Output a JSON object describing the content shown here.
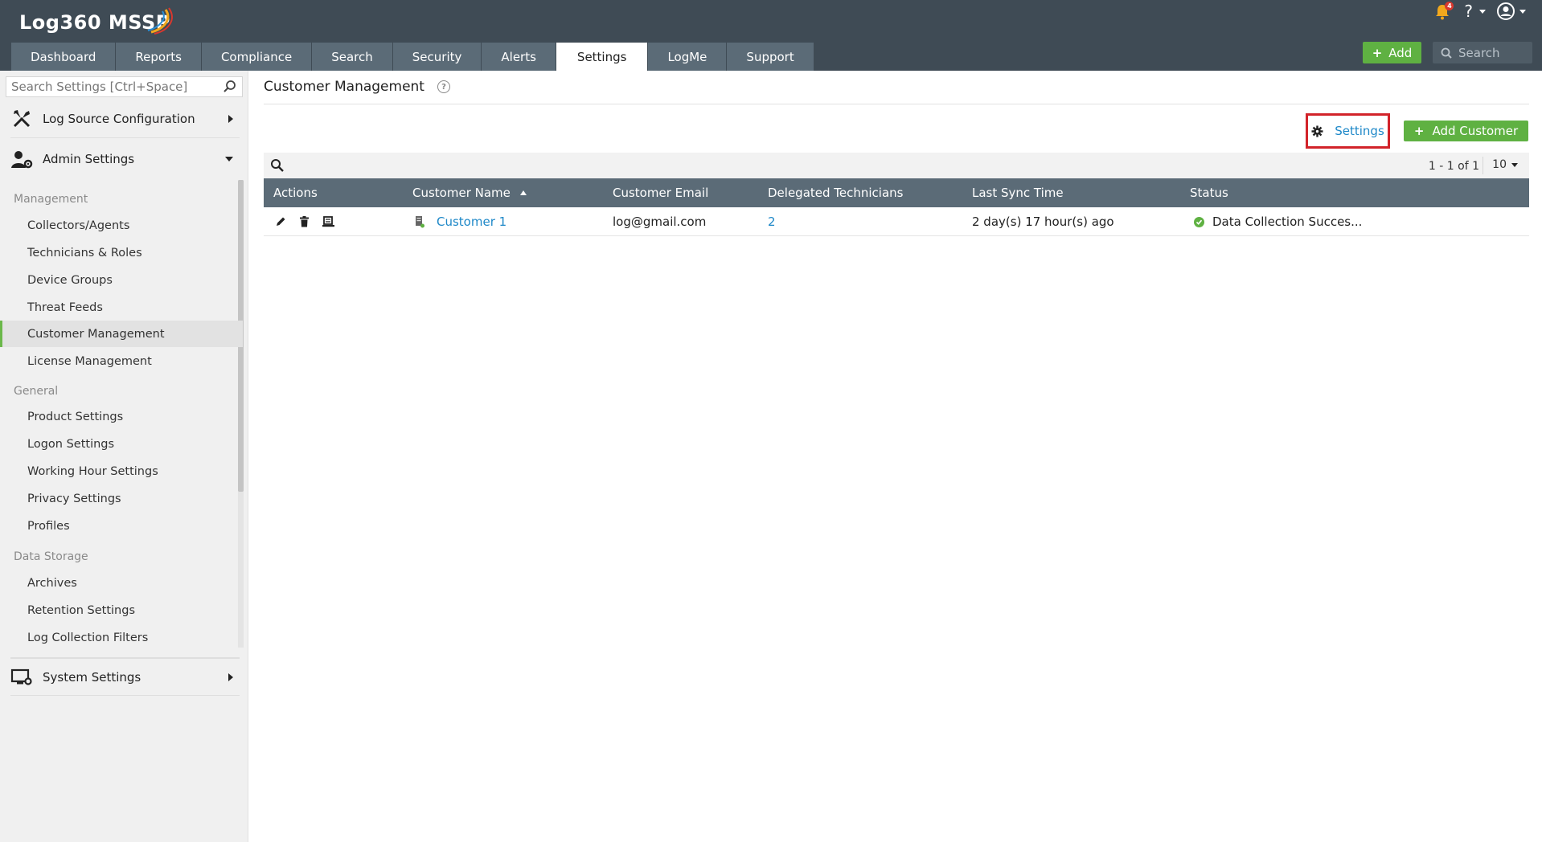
{
  "app": {
    "logo_text": "Log360 MSSP",
    "notification_count": "4",
    "help_label": "?"
  },
  "nav": {
    "tabs": [
      {
        "label": "Dashboard"
      },
      {
        "label": "Reports"
      },
      {
        "label": "Compliance"
      },
      {
        "label": "Search"
      },
      {
        "label": "Security"
      },
      {
        "label": "Alerts"
      },
      {
        "label": "Settings",
        "active": true
      },
      {
        "label": "LogMe"
      },
      {
        "label": "Support"
      }
    ],
    "add_label": "Add",
    "search_placeholder": "Search"
  },
  "sidebar": {
    "search_placeholder": "Search Settings [Ctrl+Space]",
    "groups": {
      "log_source": "Log Source Configuration",
      "admin": "Admin Settings",
      "system": "System Settings"
    },
    "sections": {
      "management": "Management",
      "general": "General",
      "data_storage": "Data Storage"
    },
    "management_items": [
      "Collectors/Agents",
      "Technicians & Roles",
      "Device Groups",
      "Threat Feeds",
      "Customer Management",
      "License Management"
    ],
    "general_items": [
      "Product Settings",
      "Logon Settings",
      "Working Hour Settings",
      "Privacy Settings",
      "Profiles"
    ],
    "data_storage_items": [
      "Archives",
      "Retention Settings",
      "Log Collection Filters"
    ],
    "active_item": "Customer Management"
  },
  "main": {
    "title": "Customer Management",
    "settings_label": "Settings",
    "add_customer_label": "Add Customer",
    "pager_text": "1 - 1 of 1",
    "per_page": "10",
    "columns": [
      "Actions",
      "Customer Name",
      "Customer Email",
      "Delegated Technicians",
      "Last Sync Time",
      "Status"
    ],
    "rows": [
      {
        "customer_name": "Customer 1",
        "customer_email": "log@gmail.com",
        "delegated_technicians": "2",
        "last_sync_time": "2 day(s) 17 hour(s) ago",
        "status": "Data Collection Succes..."
      }
    ]
  },
  "colors": {
    "header": "#3f4b55",
    "nav_tab": "#5b6b77",
    "accent_green": "#5fb142",
    "link_blue": "#1e88c8",
    "highlight_red": "#d2232a"
  }
}
